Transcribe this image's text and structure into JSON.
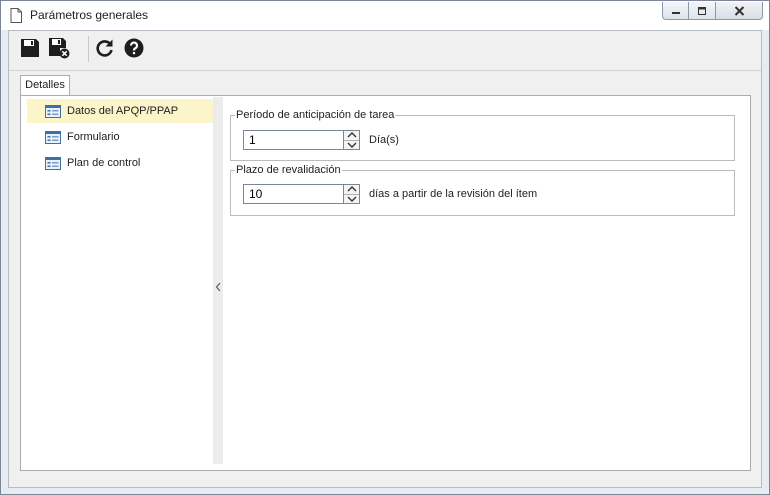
{
  "window": {
    "title": "Parámetros generales",
    "controls": [
      "minimize-icon",
      "maximize-icon",
      "close-icon"
    ]
  },
  "toolbar": {
    "buttons": [
      {
        "icon": "save-icon",
        "tooltip": ""
      },
      {
        "icon": "save-close-icon",
        "tooltip": ""
      },
      {
        "icon": "refresh-icon",
        "tooltip": ""
      },
      {
        "icon": "help-icon",
        "tooltip": ""
      }
    ]
  },
  "tabs": [
    {
      "label": "Detalles",
      "active": true
    }
  ],
  "tree": {
    "items": [
      {
        "label": "Datos del APQP/PPAP",
        "icon": "form-icon",
        "selected": true
      },
      {
        "label": "Formulario",
        "icon": "form-icon",
        "selected": false
      },
      {
        "label": "Plan de control",
        "icon": "form-icon",
        "selected": false
      }
    ]
  },
  "fields": {
    "anticipation": {
      "legend": "Período de anticipación de tarea",
      "value": "1",
      "unit": "Día(s)"
    },
    "revalidation": {
      "legend": "Plazo de revalidación",
      "value": "10",
      "unit": "días a partir de la revisión del ítem"
    }
  },
  "colors": {
    "selected_row": "#fbf5c9",
    "window_frame": "#e7ecf3",
    "border": "#a8adb4"
  }
}
